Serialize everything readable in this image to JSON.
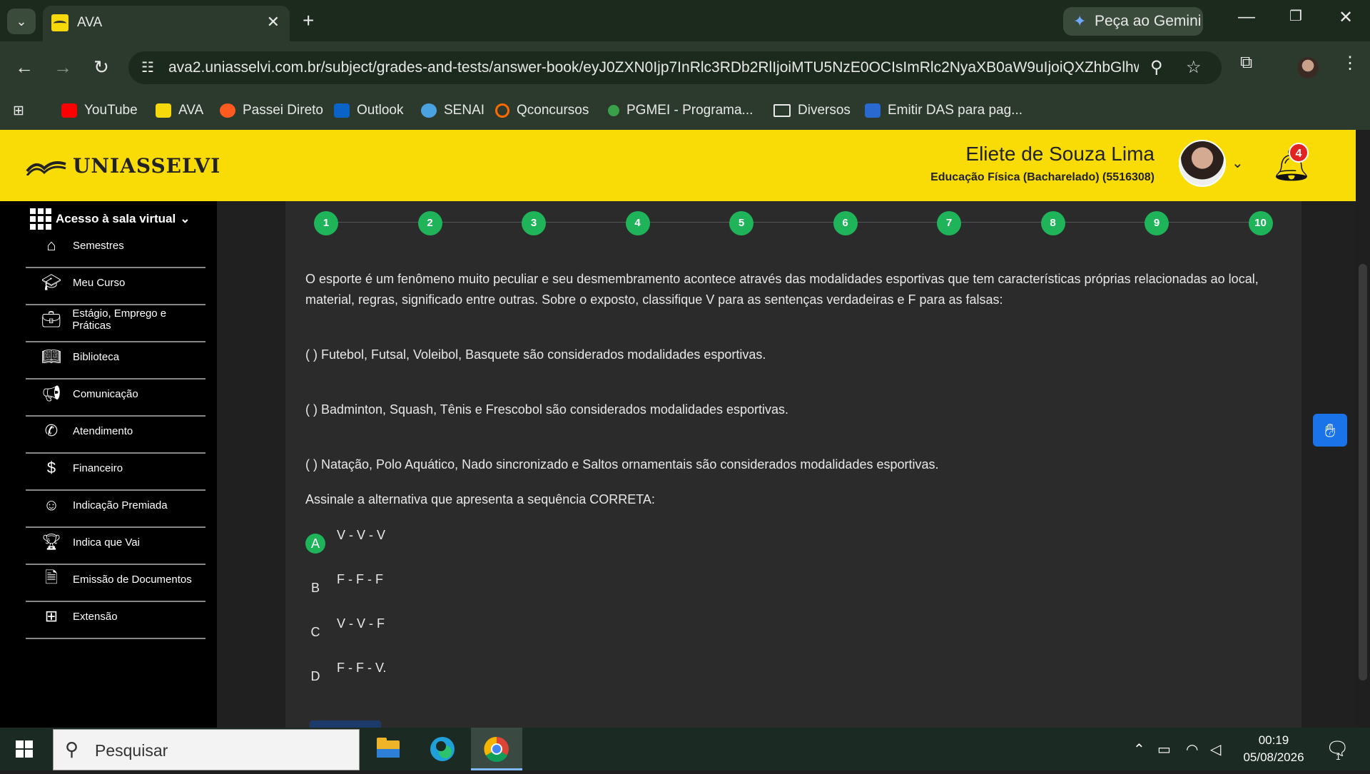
{
  "browser": {
    "tab_title": "AVA",
    "tab_close": "✕",
    "new_tab": "+",
    "gemini_label": "Peça ao Gemini",
    "url": "ava2.uniasselvi.com.br/subject/grades-and-tests/answer-book/eyJ0ZXN0Ijp7InRlc3RDb2RlIjoiMTU5NzE0OCIsImRlc2NyaXB0aW9uIjoiQXZhbGlhw...",
    "bookmarks": [
      "YouTube",
      "AVA",
      "Passei Direto",
      "Outlook",
      "SENAI",
      "Qconcursos",
      "PGMEI - Programa...",
      "Diversos",
      "Emitir DAS para pag..."
    ]
  },
  "header": {
    "logo": "UNIASSELVI",
    "user_name": "Eliete de Souza Lima",
    "user_course": "Educação Física (Bacharelado) (5516308)",
    "notification_count": "4"
  },
  "sidebar": {
    "sala_label": "Acesso à sala virtual",
    "items": [
      {
        "label": "Semestres",
        "icon": "home-icon"
      },
      {
        "label": "Meu Curso",
        "icon": "graduation-cap-icon"
      },
      {
        "label": "Estágio, Emprego e Práticas",
        "icon": "briefcase-icon"
      },
      {
        "label": "Biblioteca",
        "icon": "book-icon"
      },
      {
        "label": "Comunicação",
        "icon": "megaphone-icon"
      },
      {
        "label": "Atendimento",
        "icon": "phone-icon"
      },
      {
        "label": "Financeiro",
        "icon": "dollar-icon"
      },
      {
        "label": "Indicação Premiada",
        "icon": "users-icon"
      },
      {
        "label": "Indica que Vai",
        "icon": "trophy-icon"
      },
      {
        "label": "Emissão de Documentos",
        "icon": "document-icon"
      },
      {
        "label": "Extensão",
        "icon": "extension-icon"
      }
    ]
  },
  "question": {
    "steps": [
      "1",
      "2",
      "3",
      "4",
      "5",
      "6",
      "7",
      "8",
      "9",
      "10"
    ],
    "statement": "O esporte é um fenômeno muito peculiar e seu desmembramento acontece através das modalidades esportivas que tem características próprias relacionadas ao local, material, regras, significado entre outras. Sobre o exposto, classifique V para as sentenças verdadeiras e F para as falsas:",
    "sentences": [
      "(    ) Futebol, Futsal, Voleibol, Basquete são considerados modalidades esportivas.",
      "(    ) Badminton, Squash, Tênis e Frescobol são considerados modalidades esportivas.",
      "(    ) Natação, Polo Aquático, Nado sincronizado e Saltos ornamentais são considerados modalidades esportivas."
    ],
    "prompt": "Assinale a alternativa que apresenta a sequência CORRETA:",
    "options": [
      {
        "letter": "A",
        "text": "V - V - V",
        "selected": true
      },
      {
        "letter": "B",
        "text": "F - F - F",
        "selected": false
      },
      {
        "letter": "C",
        "text": "V - V - F",
        "selected": false
      },
      {
        "letter": "D",
        "text": "F - F - V.",
        "selected": false
      }
    ]
  },
  "taskbar": {
    "search_placeholder": "Pesquisar",
    "time": "00:19",
    "date": "05/08/2026",
    "notification_count": "1"
  },
  "colors": {
    "accent_yellow": "#f9dc05",
    "step_green": "#1fb45a",
    "panel": "#2b2b2b"
  }
}
